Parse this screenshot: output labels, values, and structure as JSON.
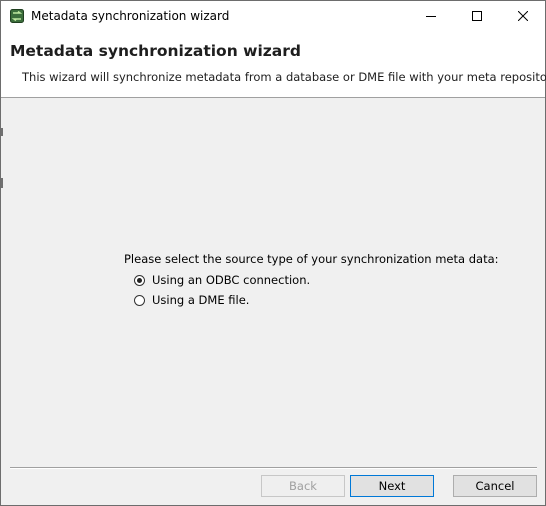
{
  "window": {
    "title": "Metadata synchronization wizard",
    "icon": "synchronization-app-icon",
    "controls": [
      "minimize-icon",
      "maximize-icon",
      "close-icon"
    ]
  },
  "header": {
    "title": "Metadata synchronization wizard",
    "description": "This wizard will synchronize metadata from a database or DME file with your meta repository."
  },
  "content": {
    "prompt": "Please select the source type of your synchronization meta data:",
    "options": [
      {
        "label": "Using an ODBC connection.",
        "selected": true
      },
      {
        "label": "Using a DME file.",
        "selected": false
      }
    ]
  },
  "buttons": {
    "back": "Back",
    "next": "Next",
    "cancel": "Cancel"
  },
  "colors": {
    "background": "#f0f0f0",
    "header_background": "#ffffff",
    "default_button_border": "#0078d7"
  }
}
